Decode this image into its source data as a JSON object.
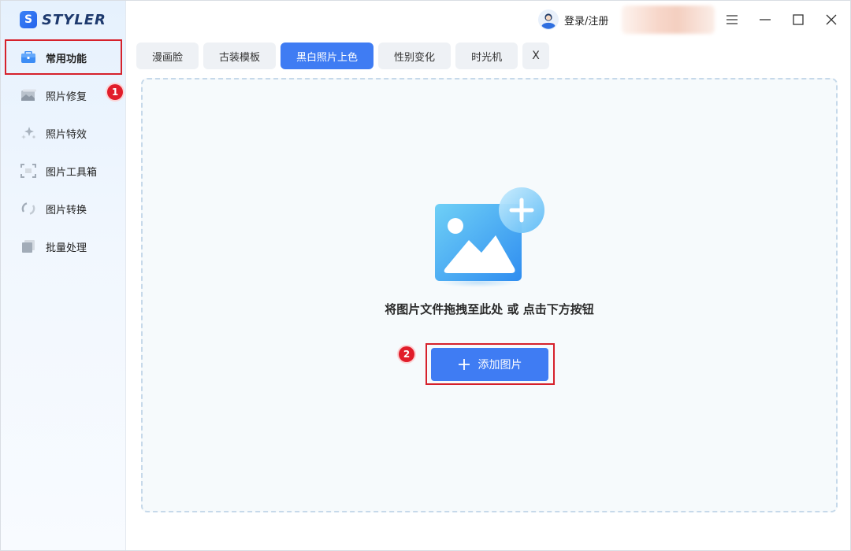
{
  "app": {
    "brand_mark": "S",
    "brand_name": "STYLER"
  },
  "sidebar": {
    "items": [
      {
        "label": "常用功能",
        "icon": "toolbox-icon"
      },
      {
        "label": "照片修复",
        "icon": "photo-restore-icon"
      },
      {
        "label": "照片特效",
        "icon": "sparkle-effects-icon"
      },
      {
        "label": "图片工具箱",
        "icon": "crop-frame-icon"
      },
      {
        "label": "图片转换",
        "icon": "convert-circle-icon"
      },
      {
        "label": "批量处理",
        "icon": "batch-stack-icon"
      }
    ],
    "active_index": 0
  },
  "header": {
    "login_label": "登录/注册",
    "controls": [
      "menu-icon",
      "minimize-icon",
      "maximize-icon",
      "close-icon"
    ]
  },
  "tabs": [
    {
      "label": "漫画脸"
    },
    {
      "label": "古装模板"
    },
    {
      "label": "黑白照片上色",
      "active": true
    },
    {
      "label": "性别变化"
    },
    {
      "label": "时光机"
    }
  ],
  "tab_close_label": "X",
  "main": {
    "drop_hint": "将图片文件拖拽至此处 或 点击下方按钮",
    "add_button_label": "添加图片"
  },
  "annotations": {
    "badge_1": "1",
    "badge_2": "2"
  },
  "colors": {
    "accent": "#3f7cf3",
    "highlight_red": "#d6212b",
    "badge_red": "#e11d2a",
    "sidebar_bg": "#e6f1fd",
    "tab_bg": "#eef1f5",
    "dropzone_border": "#c6d9ea"
  }
}
